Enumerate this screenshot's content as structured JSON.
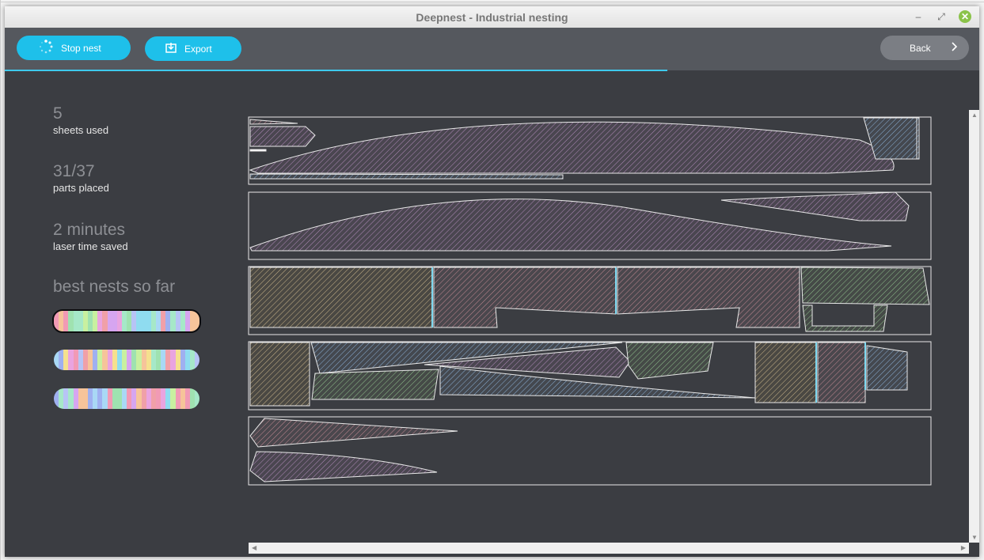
{
  "window": {
    "title": "Deepnest - Industrial nesting"
  },
  "toolbar": {
    "stop_label": "Stop nest",
    "export_label": "Export",
    "back_label": "Back"
  },
  "stats": [
    {
      "value": "5",
      "label": "sheets used"
    },
    {
      "value": "31/37",
      "label": "parts placed"
    },
    {
      "value": "2 minutes",
      "label": "laser time saved"
    }
  ],
  "best_nests": {
    "title": "best nests so far",
    "count": 3
  },
  "progress": 0.68,
  "colors": {
    "accent": "#1ec0ea",
    "background": "#3b3d42",
    "toolbar": "#55585e",
    "sheet_outline": "#d8d8d8",
    "part_red": "#c48a93",
    "part_purple": "#b08bb9",
    "part_green": "#8fbf8c",
    "part_blue": "#8bb0d6",
    "part_tan": "#c9b48a"
  },
  "icons": {
    "stop": "spinner-icon",
    "export": "export-icon",
    "back": "chevron-right-icon",
    "minimize": "minimize-icon",
    "restore": "restore-icon",
    "close": "close-icon"
  }
}
